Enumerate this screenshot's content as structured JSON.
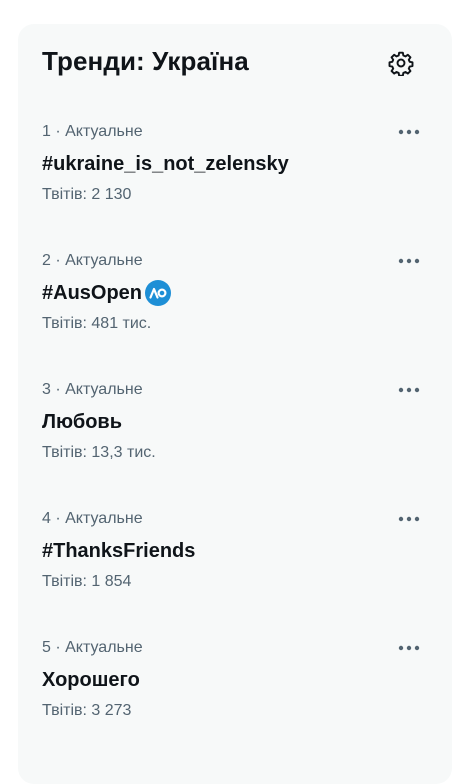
{
  "header": {
    "title": "Тренди: Україна",
    "settings_icon": "gear-icon"
  },
  "trends": [
    {
      "meta": "1 · Актуальне",
      "name": "#ukraine_is_not_zelensky",
      "count": "Твітів: 2 130"
    },
    {
      "meta": "2 · Актуальне",
      "name": "#AusOpen",
      "count": "Твітів: 481 тис.",
      "badge_icon": "ausopen-logo-icon"
    },
    {
      "meta": "3 · Актуальне",
      "name": "Любовь",
      "count": "Твітів: 13,3 тис."
    },
    {
      "meta": "4 · Актуальне",
      "name": "#ThanksFriends",
      "count": "Твітів: 1 854"
    },
    {
      "meta": "5 · Актуальне",
      "name": "Хорошего",
      "count": "Твітів: 3 273"
    }
  ],
  "colors": {
    "panel_bg": "#f7f9f9",
    "primary_text": "#0f1419",
    "secondary_text": "#536471",
    "badge": "#1e8fd6"
  }
}
